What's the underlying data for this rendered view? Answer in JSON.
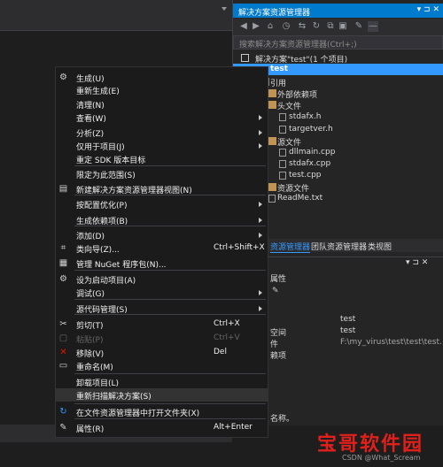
{
  "solution_explorer": {
    "title": "解决方案资源管理器",
    "title_buttons": "▾ ⊐ ✕",
    "search_placeholder": "搜索解决方案资源管理器(Ctrl+;)",
    "tree": {
      "solution": "解决方案\"test\"(1 个项目)",
      "project": "test",
      "references": "引用",
      "external": "外部依赖项",
      "headers": "头文件",
      "stdafx_h": "stdafx.h",
      "targetver_h": "targetver.h",
      "sources": "源文件",
      "dllmain": "dllmain.cpp",
      "stdafx_cpp": "stdafx.cpp",
      "test_cpp": "test.cpp",
      "resources": "资源文件",
      "readme": "ReadMe.txt"
    },
    "tabs": [
      "资源管理器",
      "团队资源管理器",
      "类视图"
    ]
  },
  "properties": {
    "title": "属性",
    "title_buttons": "▾ ⊐ ✕",
    "row_value_1": "test",
    "row_label_2": "空间",
    "row_value_2": "test",
    "row_label_3": "件",
    "row_value_3": "F:\\my_virus\\test\\test\\test.vcxp",
    "row_label_4": "赖项",
    "description": "名称。"
  },
  "context_menu": {
    "items": [
      {
        "label": "生成(U)",
        "shortcut": "",
        "submenu": false,
        "disabled": false,
        "icon": "build-icon"
      },
      {
        "label": "重新生成(E)",
        "shortcut": "",
        "submenu": false,
        "disabled": false,
        "icon": ""
      },
      {
        "label": "清理(N)",
        "shortcut": "",
        "submenu": false,
        "disabled": false,
        "icon": ""
      },
      {
        "label": "查看(W)",
        "shortcut": "",
        "submenu": true,
        "disabled": false,
        "icon": ""
      },
      {
        "label": "分析(Z)",
        "shortcut": "",
        "submenu": true,
        "disabled": false,
        "icon": ""
      },
      {
        "label": "仅用于项目(J)",
        "shortcut": "",
        "submenu": true,
        "disabled": false,
        "icon": ""
      },
      {
        "label": "重定 SDK 版本目标",
        "shortcut": "",
        "submenu": false,
        "disabled": false,
        "icon": ""
      },
      {
        "label": "限定为此范围(S)",
        "shortcut": "",
        "submenu": false,
        "disabled": false,
        "icon": ""
      },
      {
        "label": "新建解决方案资源管理器视图(N)",
        "shortcut": "",
        "submenu": false,
        "disabled": false,
        "icon": "new-view-icon"
      },
      {
        "label": "按配置优化(P)",
        "shortcut": "",
        "submenu": true,
        "disabled": false,
        "icon": ""
      },
      {
        "label": "生成依赖项(B)",
        "shortcut": "",
        "submenu": true,
        "disabled": false,
        "icon": ""
      },
      {
        "label": "添加(D)",
        "shortcut": "",
        "submenu": true,
        "disabled": false,
        "icon": ""
      },
      {
        "label": "类向导(Z)...",
        "shortcut": "Ctrl+Shift+X",
        "submenu": false,
        "disabled": false,
        "icon": "class-wizard-icon"
      },
      {
        "label": "管理 NuGet 程序包(N)...",
        "shortcut": "",
        "submenu": false,
        "disabled": false,
        "icon": "nuget-icon"
      },
      {
        "label": "设为启动项目(A)",
        "shortcut": "",
        "submenu": false,
        "disabled": false,
        "icon": "gear-icon"
      },
      {
        "label": "调试(G)",
        "shortcut": "",
        "submenu": true,
        "disabled": false,
        "icon": ""
      },
      {
        "label": "源代码管理(S)",
        "shortcut": "",
        "submenu": true,
        "disabled": false,
        "icon": ""
      },
      {
        "label": "剪切(T)",
        "shortcut": "Ctrl+X",
        "submenu": false,
        "disabled": false,
        "icon": "scissors-icon"
      },
      {
        "label": "粘贴(P)",
        "shortcut": "Ctrl+V",
        "submenu": false,
        "disabled": true,
        "icon": "paste-icon"
      },
      {
        "label": "移除(V)",
        "shortcut": "Del",
        "submenu": false,
        "disabled": false,
        "icon": "remove-icon"
      },
      {
        "label": "重命名(M)",
        "shortcut": "",
        "submenu": false,
        "disabled": false,
        "icon": "rename-icon"
      },
      {
        "label": "卸载项目(L)",
        "shortcut": "",
        "submenu": false,
        "disabled": false,
        "icon": ""
      },
      {
        "label": "重新扫描解决方案(S)",
        "shortcut": "",
        "submenu": false,
        "disabled": false,
        "icon": ""
      },
      {
        "label": "在文件资源管理器中打开文件夹(X)",
        "shortcut": "",
        "submenu": false,
        "disabled": false,
        "icon": "open-folder-icon"
      },
      {
        "label": "属性(R)",
        "shortcut": "Alt+Enter",
        "submenu": false,
        "disabled": false,
        "icon": "wrench-icon"
      }
    ]
  },
  "watermark": {
    "text": "宝哥软件园",
    "credit": "CSDN @What_Scream"
  },
  "colors": {
    "accent": "#007acc",
    "selection": "#3399ff",
    "menu_bg": "#1b1b1c",
    "remove_red": "#e51400",
    "watermark_red": "#e0201a"
  }
}
